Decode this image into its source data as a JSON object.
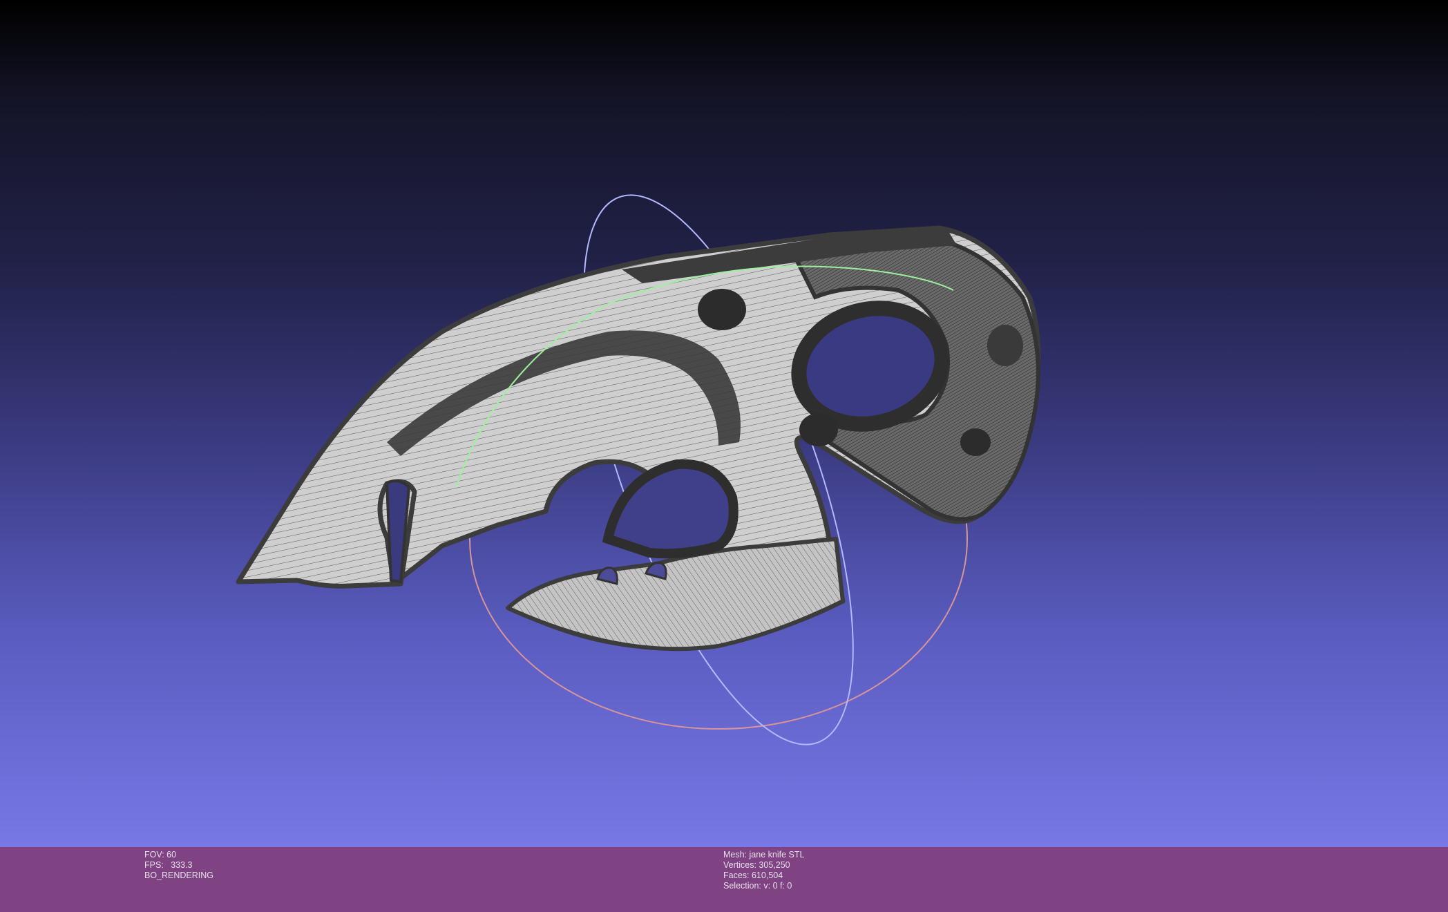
{
  "app": {
    "window_title": ""
  },
  "viewport": {
    "background_top": "#000000",
    "background_bottom": "#7878e6",
    "mesh_fill": "#c8c8c8",
    "mesh_edge": "#3c3c3c",
    "trackball_colors": {
      "vertical_ring": "#b4b8ff",
      "horizontal_ring": "#e09090",
      "equator_arc": "#90f090"
    }
  },
  "status_bar": {
    "background": "#7f4283",
    "left": {
      "fov": "FOV: 60",
      "fps": "FPS:   333.3",
      "render_mode": "BO_RENDERING"
    },
    "right": {
      "mesh": "Mesh: jane knife STL",
      "vertices": "Vertices: 305,250",
      "faces": "Faces: 610,504",
      "selection": "Selection: v: 0 f: 0"
    }
  }
}
